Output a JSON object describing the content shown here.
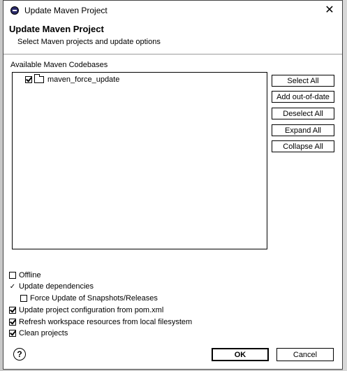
{
  "window": {
    "title": "Update Maven Project"
  },
  "header": {
    "title": "Update Maven Project",
    "message": "Select Maven projects and update options"
  },
  "codebases": {
    "label": "Available Maven Codebases",
    "items": [
      {
        "name": "maven_force_update",
        "checked": true
      }
    ]
  },
  "side_buttons": {
    "select_all": "Select All",
    "add_out_of_date": "Add out-of-date",
    "deselect_all": "Deselect All",
    "expand_all": "Expand All",
    "collapse_all": "Collapse All"
  },
  "options": {
    "offline": {
      "label": "Offline",
      "checked": false
    },
    "update_dependencies": {
      "label": "Update dependencies",
      "checked": true
    },
    "force_update": {
      "label": "Force Update of Snapshots/Releases",
      "checked": false
    },
    "update_config": {
      "label": "Update project configuration from pom.xml",
      "checked": true
    },
    "refresh_workspace": {
      "label": "Refresh workspace resources from local filesystem",
      "checked": true
    },
    "clean_projects": {
      "label": "Clean projects",
      "checked": true
    }
  },
  "footer": {
    "help_symbol": "?",
    "ok_label": "OK",
    "cancel_label": "Cancel"
  }
}
